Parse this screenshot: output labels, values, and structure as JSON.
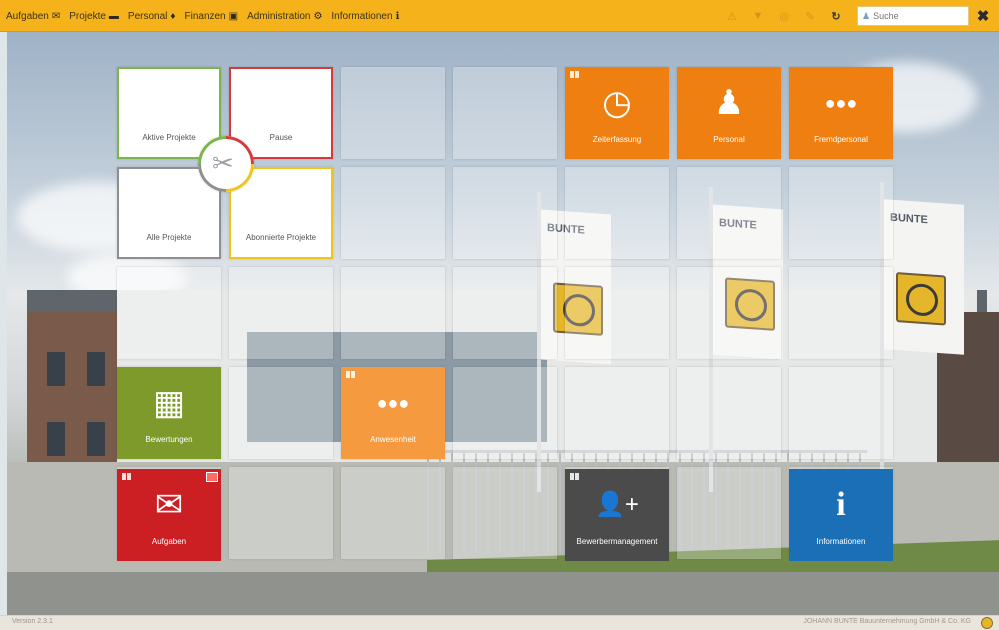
{
  "menu": [
    {
      "label": "Aufgaben",
      "icon": "envelope-icon",
      "glyph": "✉"
    },
    {
      "label": "Projekte",
      "icon": "briefcase-icon",
      "glyph": "▬"
    },
    {
      "label": "Personal",
      "icon": "person-icon",
      "glyph": "♦"
    },
    {
      "label": "Finanzen",
      "icon": "money-icon",
      "glyph": "▣"
    },
    {
      "label": "Administration",
      "icon": "gears-icon",
      "glyph": "⚙"
    },
    {
      "label": "Informationen",
      "icon": "info-icon",
      "glyph": "ℹ"
    }
  ],
  "toolbar": {
    "warning_glyph": "⚠",
    "filter_glyph": "▼",
    "settings_glyph": "◎",
    "pin_glyph": "✎",
    "refresh_glyph": "↻",
    "search_placeholder": "Suche",
    "close_glyph": "✖"
  },
  "tiles": {
    "aktive_projekte": "Aktive Projekte",
    "pause": "Pause",
    "alle_projekte": "Alle Projekte",
    "abonnierte_projekte": "Abonnierte Projekte",
    "zeiterfassung": "Zeiterfassung",
    "personal": "Personal",
    "fremdpersonal": "Fremdpersonal",
    "bewertungen": "Bewertungen",
    "anwesenheit": "Anwesenheit",
    "aufgaben": "Aufgaben",
    "bewerbermanagement": "Bewerbermanagement",
    "informationen": "Informationen"
  },
  "tile_icons": {
    "hub": "✂",
    "zeiterfassung": "◷",
    "personal": "♟",
    "fremdpersonal": "●●●",
    "bewertungen": "▦",
    "anwesenheit": "●●●",
    "aufgaben": "✉",
    "bewerbermanagement": "👤+",
    "informationen": "i"
  },
  "colors": {
    "topbar": "#f6b21a",
    "orange": "#f07f12",
    "light_orange": "#f59a3f",
    "green": "#7d9a2a",
    "red": "#cc1f24",
    "dark_gray": "#4b4b4b",
    "blue": "#1a6fb7",
    "border_green": "#7ab648",
    "border_red": "#d63a3a",
    "border_gray": "#8f8f8f",
    "border_yellow": "#f0c419"
  },
  "flags": {
    "text": "BUNTE"
  },
  "footer": {
    "version": "Version 2.3.1",
    "company": "JOHANN BUNTE Bauunternehmung GmbH & Co. KG"
  }
}
